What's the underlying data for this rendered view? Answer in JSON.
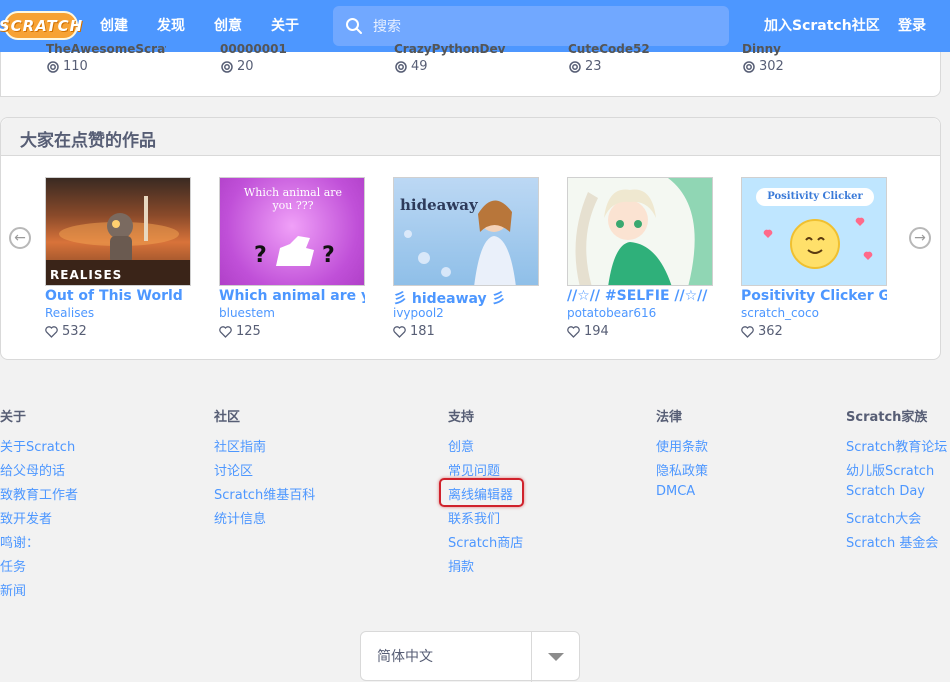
{
  "header": {
    "logo": "SCRATCH",
    "nav": [
      "创建",
      "发现",
      "创意",
      "关于"
    ],
    "search_placeholder": "搜索",
    "join": "加入Scratch社区",
    "signin": "登录"
  },
  "prev_row": {
    "titles": [
      "TheAwesomeScratch",
      "00000001",
      "CrazyPythonDev",
      "CuteCode52",
      "Dinny"
    ],
    "remixes": [
      "110",
      "20",
      "49",
      "23",
      "302"
    ]
  },
  "liked": {
    "title": "大家在点赞的作品",
    "projects": [
      {
        "title": "Out of This World",
        "author": "Realises",
        "likes": "532",
        "thumb_text": "REALISES"
      },
      {
        "title": "Which animal are you",
        "author": "bluestem",
        "likes": "125",
        "thumb_text": "Which animal are you ???"
      },
      {
        "title": "彡 hideaway 彡",
        "author": "ivypool2",
        "likes": "181",
        "thumb_text": "hideaway"
      },
      {
        "title": "//☆// #SELFIE //☆//",
        "author": "potatobear616",
        "likes": "194",
        "thumb_text": ""
      },
      {
        "title": "Positivity Clicker Game",
        "author": "scratch_coco",
        "likes": "362",
        "thumb_text": "Positivity Clicker"
      }
    ]
  },
  "footer": {
    "columns": [
      {
        "heading": "关于",
        "links": [
          "关于Scratch",
          "给父母的话",
          "致教育工作者",
          "致开发者",
          "鸣谢：",
          "任务",
          "新闻"
        ]
      },
      {
        "heading": "社区",
        "links": [
          "社区指南",
          "讨论区",
          "Scratch维基百科",
          "统计信息"
        ]
      },
      {
        "heading": "支持",
        "links": [
          "创意",
          "常见问题",
          "离线编辑器",
          "联系我们",
          "Scratch商店",
          "捐款"
        ]
      },
      {
        "heading": "法律",
        "links": [
          "使用条款",
          "隐私政策",
          "DMCA"
        ]
      },
      {
        "heading": "Scratch家族",
        "links": [
          "Scratch教育论坛",
          "幼儿版Scratch",
          "Scratch Day",
          "Scratch大会",
          "Scratch 基金会"
        ]
      }
    ],
    "language": "简体中文"
  },
  "colors": {
    "brand": "#4d97ff",
    "highlight": "#d0222c"
  }
}
